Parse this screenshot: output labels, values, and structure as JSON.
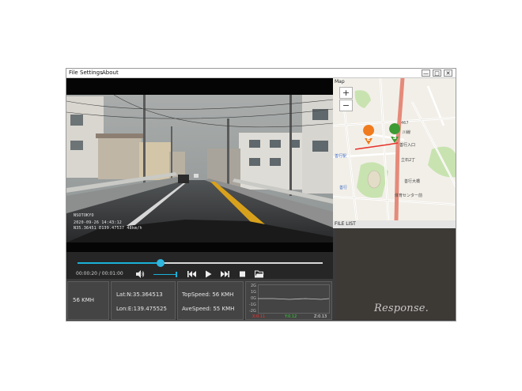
{
  "menu": {
    "file": "File",
    "settings": "Settings",
    "about": "About"
  },
  "window_controls": {
    "minimize": "—",
    "maximize": "□",
    "close": "✕"
  },
  "video": {
    "overlay_brand": "NSOTOKYO",
    "overlay_datetime": "2020-09-26 14:43:12",
    "overlay_gps": "N35.36451 E139.47537 48km/h"
  },
  "player": {
    "time_display": "00:00:20 / 00:01:00",
    "progress_fraction": 0.34,
    "volume_fraction": 0.95,
    "icons": [
      "volume-icon",
      "skip-previous-icon",
      "play-icon",
      "skip-next-icon",
      "stop-icon",
      "open-folder-icon"
    ]
  },
  "stats": {
    "speed": "56 KMH",
    "lat": "Lat:N:35.364513",
    "lon": "Lon:E:139.475525",
    "top_speed": "TopSpeed: 56 KMH",
    "ave_speed": "AveSpeed: 55 KMH"
  },
  "gsensor": {
    "ticks": [
      "2G",
      "1G",
      "0G",
      "-1G",
      "-2G"
    ],
    "x_label": "X:0.11",
    "y_label": "Y:0.12",
    "z_label": "Z:0.13",
    "colors": {
      "x": "#ff3030",
      "y": "#36d336",
      "z": "#e6e6e6",
      "trace": "#c8c8c8"
    }
  },
  "map": {
    "label": "Map",
    "zoom_in": "+",
    "zoom_out": "−",
    "marker_end": "E",
    "marker_start": "S",
    "labels": [
      "467",
      "川線",
      "善行入口",
      "善行",
      "立石2丁",
      "善行大橋",
      "体育センター前",
      "善行駅"
    ],
    "colors": {
      "end": "#f07b1e",
      "start": "#3e9a35",
      "route": "#e8302a",
      "road": "#e58a7a",
      "park": "#c8e3b0"
    }
  },
  "file_list": {
    "label": "FILE LIST",
    "watermark": "Response."
  }
}
